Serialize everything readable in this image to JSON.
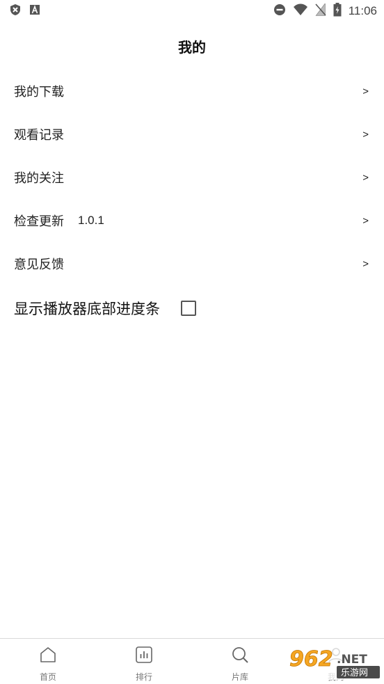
{
  "status_bar": {
    "time": "11:06",
    "left_icons": [
      "shield-x-icon",
      "font-a-icon"
    ],
    "right_icons": [
      "do-not-disturb-icon",
      "wifi-icon",
      "no-sim-icon",
      "battery-charging-icon"
    ]
  },
  "header": {
    "title": "我的"
  },
  "menu": {
    "items": [
      {
        "label": "我的下载",
        "chevron": ">"
      },
      {
        "label": "观看记录",
        "chevron": ">"
      },
      {
        "label": "我的关注",
        "chevron": ">"
      },
      {
        "label": "检查更新",
        "version": "1.0.1",
        "chevron": ">"
      },
      {
        "label": "意见反馈",
        "chevron": ">"
      }
    ]
  },
  "settings": {
    "progress_bar_label": "显示播放器底部进度条",
    "progress_bar_checked": false
  },
  "bottom_nav": {
    "items": [
      {
        "label": "首页",
        "icon": "home-icon"
      },
      {
        "label": "排行",
        "icon": "ranking-icon"
      },
      {
        "label": "片库",
        "icon": "search-icon"
      },
      {
        "label": "我的",
        "icon": "profile-icon"
      }
    ]
  },
  "watermark": {
    "text_top": "962.NET",
    "text_bottom": "乐游网"
  },
  "colors": {
    "text": "#222222",
    "nav_label": "#777777",
    "divider": "#d9d9d9",
    "watermark_orange": "#f5a623"
  }
}
